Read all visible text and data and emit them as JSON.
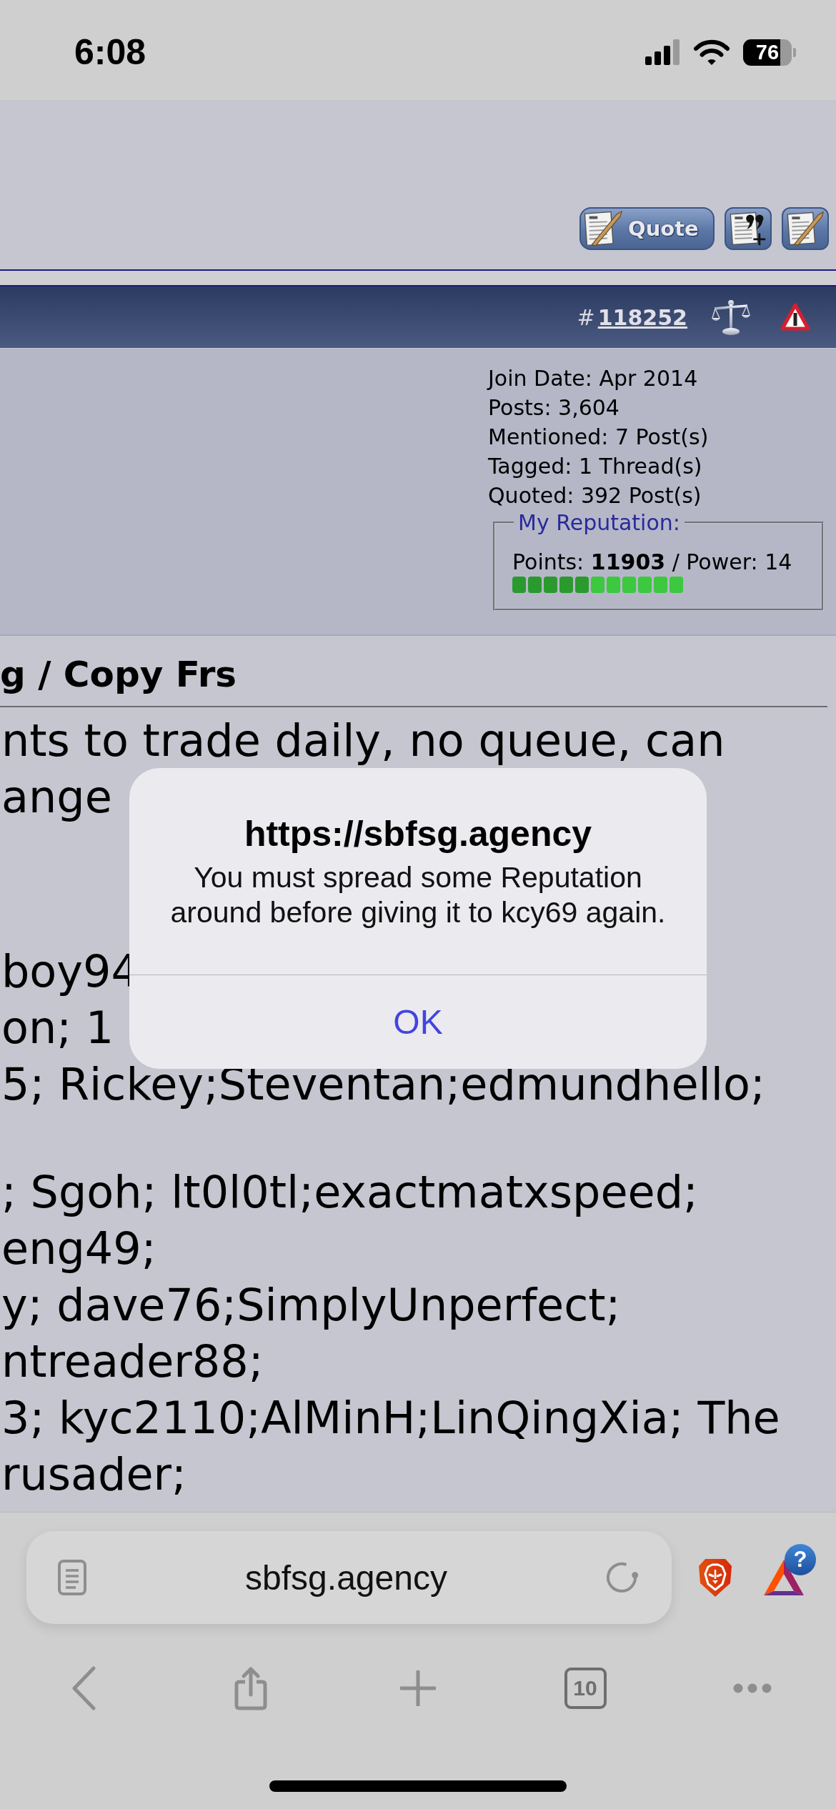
{
  "status_bar": {
    "time": "6:08",
    "battery": "76"
  },
  "post_toolbar": {
    "quote_button": "Quote"
  },
  "post_header": {
    "hash": "#",
    "post_number": "118252"
  },
  "user_info": {
    "lines": [
      "Join Date: Apr 2014",
      "Posts: 3,604",
      "Mentioned: 7 Post(s)",
      "Tagged: 1 Thread(s)",
      "Quoted: 392 Post(s)"
    ],
    "reputation": {
      "legend": "My Reputation:",
      "points": "Points: **11903** / Power: 14",
      "pips": [
        {
          "color": "#2a9a2e"
        },
        {
          "color": "#2a9a2e"
        },
        {
          "color": "#2a9a2e"
        },
        {
          "color": "#2a9a2e"
        },
        {
          "color": "#2a9a2e"
        },
        {
          "color": "#3cc83f"
        },
        {
          "color": "#3cc83f"
        },
        {
          "color": "#3cc83f"
        },
        {
          "color": "#3cc83f"
        },
        {
          "color": "#3cc83f"
        },
        {
          "color": "#3cc83f"
        }
      ]
    }
  },
  "post": {
    "title": "g / Copy Frs",
    "paragraphs": [
      [
        "nts to trade daily, no queue, can",
        "ange"
      ],
      [
        "boy94",
        "on; 1",
        "5; Rickey;Steventan;edmundhello;"
      ],
      [
        "; Sgoh; lt0l0tl;exactmatxspeed;",
        "eng49;",
        "y; dave76;SimplyUnperfect;",
        "ntreader88;",
        "3; kyc2110;AlMinH;LinQingXia; The",
        "rusader;"
      ]
    ]
  },
  "alert": {
    "title": "https://sbfsg.agency",
    "message": "You must spread some Reputation around before giving it to kcy69 again.",
    "button": "OK"
  },
  "browser": {
    "address": "sbfsg.agency",
    "badge": "?",
    "tab_count": "10"
  }
}
